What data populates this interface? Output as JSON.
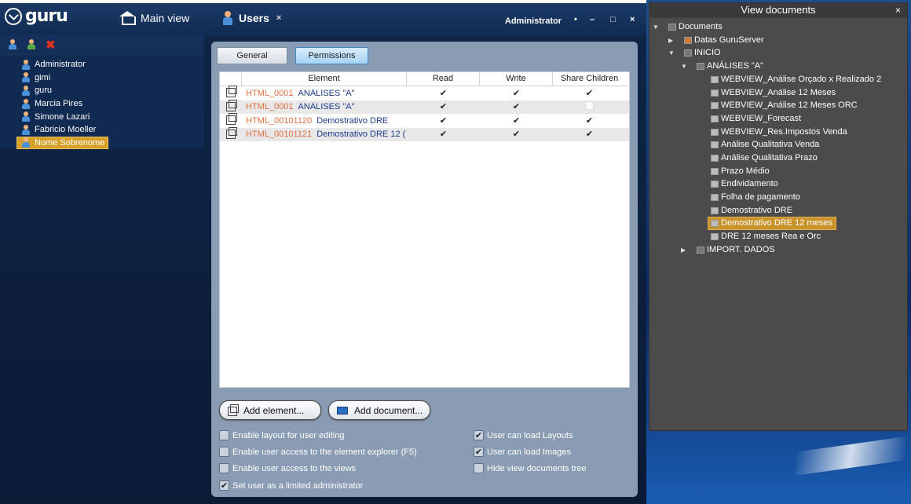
{
  "header": {
    "logo_text": "guru",
    "tabs": [
      {
        "label": "Main view",
        "icon": "house-icon"
      },
      {
        "label": "Users",
        "icon": "user-icon",
        "close": "×"
      }
    ],
    "user": "Administrator",
    "window_controls": [
      "•",
      "–",
      "□",
      "×"
    ]
  },
  "users": {
    "toolbar": [
      "add-user-icon",
      "add-group-icon",
      "delete-icon"
    ],
    "delete_glyph": "✖",
    "items": [
      "Administrator",
      "gimi",
      "guru",
      "Marcia Pires",
      "Simone Lazari",
      "Fabricio Moeller",
      "Nome Sobrenome"
    ],
    "selected": "Nome Sobrenome"
  },
  "main": {
    "tabs": [
      "General",
      "Permissions"
    ],
    "active_tab": "Permissions",
    "columns": [
      "Element",
      "Read",
      "Write",
      "Share Children"
    ],
    "rows": [
      {
        "id": "HTML_0001",
        "name": "ANÁLISES \"A\"",
        "read": "✔",
        "write": "✔",
        "share": "✔"
      },
      {
        "id": "HTML_0001",
        "name": "ANÁLISES \"A\"",
        "read": "✔",
        "write": "✔",
        "share": ""
      },
      {
        "id": "HTML_00101120",
        "name": "Demostrativo DRE",
        "read": "✔",
        "write": "✔",
        "share": "✔"
      },
      {
        "id": "HTML_00101121",
        "name": "Demostrativo DRE 12 (",
        "read": "✔",
        "write": "✔",
        "share": "✔"
      }
    ],
    "add_element": "Add element...",
    "add_document": "Add document...",
    "options": [
      {
        "label": "Enable layout for user editing",
        "checked": "",
        "col": "left"
      },
      {
        "label": "Enable user access to the element explorer (F5)",
        "checked": "",
        "col": "left"
      },
      {
        "label": "Enable user access to the views",
        "checked": "",
        "col": "left"
      },
      {
        "label": "Set user as a limited administrator",
        "checked": "✔",
        "col": "left"
      },
      {
        "label": "User can load Layouts",
        "checked": "✔",
        "col": "right"
      },
      {
        "label": "User can load Images",
        "checked": "✔",
        "col": "right"
      },
      {
        "label": "Hide view documents tree",
        "checked": "",
        "col": "right"
      }
    ]
  },
  "tree": {
    "title": "View documents",
    "close": "×",
    "nodes": [
      {
        "label": "Documents",
        "arrow": "▼"
      },
      {
        "label": "Datas GuruServer",
        "arrow": "▶"
      },
      {
        "label": "INICIO",
        "arrow": "▼"
      },
      {
        "label": "ANÁLISES \"A\"",
        "arrow": "▼"
      },
      {
        "label": "WEBVIEW_Análise Orçado x Realizado 2",
        "arrow": ""
      },
      {
        "label": "WEBVIEW_Análise 12 Meses",
        "arrow": ""
      },
      {
        "label": "WEBVIEW_Análise 12 Meses ORC",
        "arrow": ""
      },
      {
        "label": "WEBVIEW_Forecast",
        "arrow": ""
      },
      {
        "label": "WEBVIEW_Res.Impostos  Venda",
        "arrow": ""
      },
      {
        "label": "Análise Qualitativa Venda",
        "arrow": ""
      },
      {
        "label": "Análise Qualitativa Prazo",
        "arrow": ""
      },
      {
        "label": "Prazo Médio",
        "arrow": ""
      },
      {
        "label": "Endividamento",
        "arrow": ""
      },
      {
        "label": "Folha de pagamento",
        "arrow": ""
      },
      {
        "label": "Demostrativo DRE",
        "arrow": ""
      },
      {
        "label": "Demostrativo DRE 12 meses",
        "arrow": ""
      },
      {
        "label": "DRE 12 meses Rea e Orc",
        "arrow": ""
      },
      {
        "label": "IMPORT. DADOS",
        "arrow": "▶"
      }
    ],
    "selected": "Demostrativo DRE 12 meses"
  }
}
